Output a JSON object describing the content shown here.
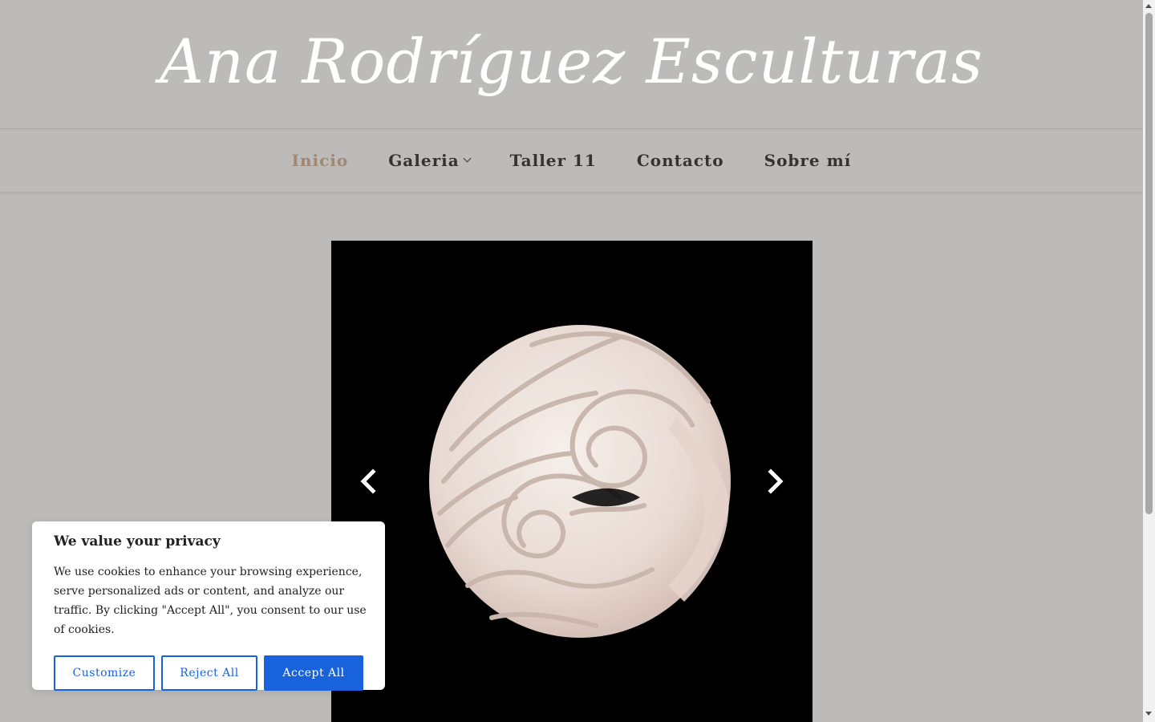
{
  "site": {
    "title": "Ana Rodríguez Esculturas"
  },
  "nav": {
    "items": [
      {
        "label": "Inicio",
        "active": true
      },
      {
        "label": "Galeria",
        "has_dropdown": true
      },
      {
        "label": "Taller 11"
      },
      {
        "label": "Contacto"
      },
      {
        "label": "Sobre mí"
      }
    ]
  },
  "slider": {
    "prev_icon": "chevron-left-icon",
    "next_icon": "chevron-right-icon",
    "image_subject": "white ceramic sculpture of a face with swirling hair on black background"
  },
  "cookie_banner": {
    "title": "We value your privacy",
    "text": "We use cookies to enhance your browsing experience, serve personalized ads or content, and analyze our traffic. By clicking \"Accept All\", you consent to our use of cookies.",
    "customize_label": "Customize",
    "reject_label": "Reject All",
    "accept_label": "Accept All"
  },
  "colors": {
    "background": "#bcbbba",
    "title": "#ffffff",
    "nav_active": "#a08872",
    "nav_text": "#333333",
    "accent_blue": "#1863dc"
  }
}
